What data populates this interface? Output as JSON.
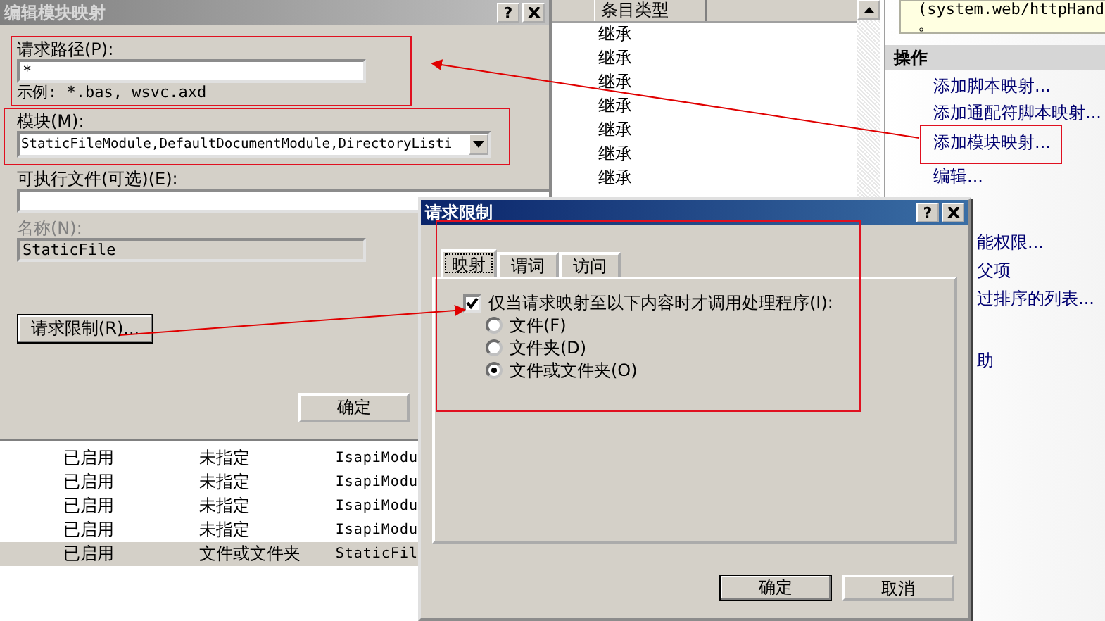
{
  "edit_dialog": {
    "title": "编辑模块映射",
    "help_label": "?",
    "request_path": {
      "label": "请求路径(P):",
      "value": "*",
      "example": "示例: *.bas, wsvc.axd"
    },
    "module": {
      "label": "模块(M):",
      "value": "StaticFileModule,DefaultDocumentModule,DirectoryListi"
    },
    "executable": {
      "label": "可执行文件(可选)(E):"
    },
    "name": {
      "label": "名称(N):",
      "value": "StaticFile",
      "disabled": true
    },
    "restrictions_button": "请求限制(R)...",
    "ok_button": "确定"
  },
  "handler_list": {
    "column_header": "条目类型",
    "rows": [
      "继承",
      "继承",
      "继承",
      "继承",
      "继承",
      "继承",
      "继承"
    ]
  },
  "actions_panel": {
    "info_text": "(system.web/httpHand",
    "info_tail": "。",
    "heading": "操作",
    "links": [
      "添加脚本映射...",
      "添加通配符脚本映射...",
      "添加模块映射...",
      "编辑..."
    ],
    "more_links": [
      "能权限...",
      "父项",
      "过排序的列表..."
    ],
    "help_link": "助"
  },
  "mappings_table": {
    "rows": [
      {
        "cells": [
          "已启用",
          "未指定",
          "IsapiModu"
        ],
        "selected": false
      },
      {
        "cells": [
          "已启用",
          "未指定",
          "IsapiModu"
        ],
        "selected": false
      },
      {
        "cells": [
          "已启用",
          "未指定",
          "IsapiModu"
        ],
        "selected": false
      },
      {
        "cells": [
          "已启用",
          "未指定",
          "IsapiModu"
        ],
        "selected": false
      },
      {
        "cells": [
          "已启用",
          "文件或文件夹",
          "StaticFil"
        ],
        "selected": true
      }
    ]
  },
  "restrictions_dialog": {
    "title": "请求限制",
    "help_label": "?",
    "tabs": [
      {
        "label": "映射",
        "selected": true
      },
      {
        "label": "谓词",
        "selected": false
      },
      {
        "label": "访问",
        "selected": false
      }
    ],
    "invoke_only": {
      "label": "仅当请求映射至以下内容时才调用处理程序(I):",
      "checked": true
    },
    "options": [
      {
        "label": "文件(F)",
        "selected": false
      },
      {
        "label": "文件夹(D)",
        "selected": false
      },
      {
        "label": "文件或文件夹(O)",
        "selected": true
      }
    ],
    "ok_button": "确定",
    "cancel_button": "取消"
  }
}
